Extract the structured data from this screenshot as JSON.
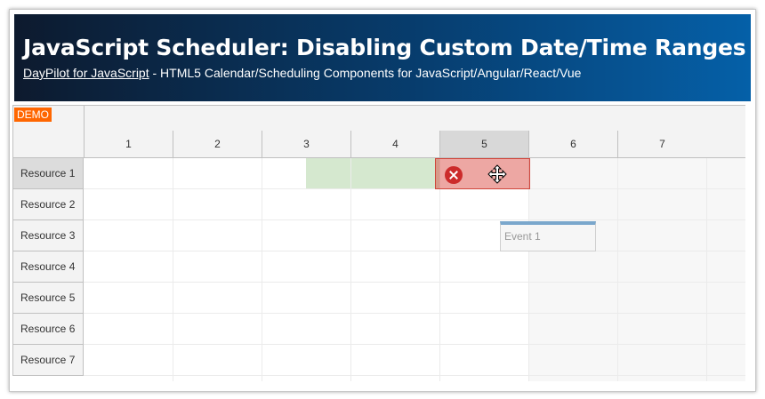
{
  "header": {
    "title": "JavaScript Scheduler: Disabling Custom Date/Time Ranges",
    "link_text": "DayPilot for JavaScript",
    "subtitle": " - HTML5 Calendar/Scheduling Components for JavaScript/Angular/React/Vue"
  },
  "scheduler": {
    "demo_badge": "DEMO",
    "columns": [
      "1",
      "2",
      "3",
      "4",
      "5",
      "6",
      "7"
    ],
    "resources": [
      "Resource 1",
      "Resource 2",
      "Resource 3",
      "Resource 4",
      "Resource 5",
      "Resource 6",
      "Resource 7"
    ],
    "events": [
      {
        "text": "Event 1",
        "resource": "Resource 3",
        "start_day": 5.68,
        "end_day": 6.76
      }
    ],
    "enabled_range": {
      "resource": "Resource 1",
      "start_day": 3.5,
      "end_day": 5.0,
      "color": "#d5e8cf"
    },
    "drag_shadow": {
      "resource": "Resource 1",
      "start_day": 4.95,
      "end_day": 6.02,
      "state": "disabled",
      "color": "#d63c32"
    },
    "disabled_from_day": 5.0,
    "colors": {
      "event_bar": "#7aa7cc",
      "demo_badge": "#ff6600",
      "selected_header": "#d8d8d8"
    }
  }
}
